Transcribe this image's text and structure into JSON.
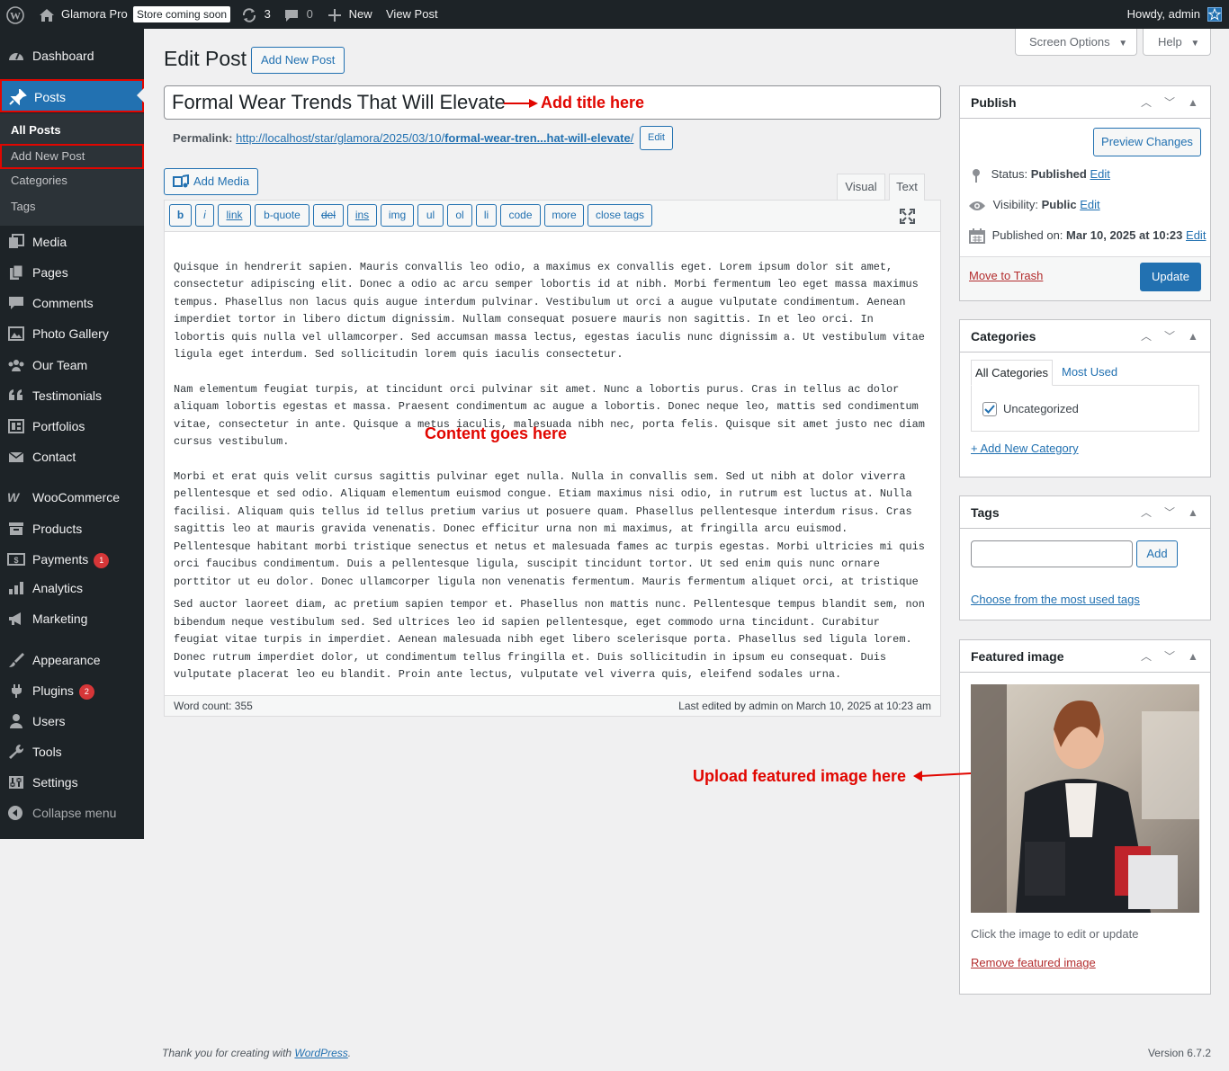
{
  "adminbar": {
    "site_name": "Glamora Pro",
    "store_badge": "Store coming soon",
    "updates_count": "3",
    "comments_count": "0",
    "new_label": "New",
    "view_post_label": "View Post",
    "howdy": "Howdy, admin"
  },
  "sidebar": {
    "dashboard": "Dashboard",
    "posts": "Posts",
    "all_posts": "All Posts",
    "add_new_post": "Add New Post",
    "categories": "Categories",
    "tags": "Tags",
    "media": "Media",
    "pages": "Pages",
    "comments": "Comments",
    "photo_gallery": "Photo Gallery",
    "our_team": "Our Team",
    "testimonials": "Testimonials",
    "portfolios": "Portfolios",
    "contact": "Contact",
    "woocommerce": "WooCommerce",
    "products": "Products",
    "payments": "Payments",
    "payments_badge": "1",
    "analytics": "Analytics",
    "marketing": "Marketing",
    "appearance": "Appearance",
    "plugins": "Plugins",
    "plugins_badge": "2",
    "users": "Users",
    "tools": "Tools",
    "settings": "Settings",
    "collapse": "Collapse menu"
  },
  "screen_options": "Screen Options",
  "help": "Help",
  "page_title": "Edit Post",
  "add_new_post_btn": "Add New Post",
  "post_title": "Formal Wear Trends That Will Elevate",
  "permalink": {
    "label": "Permalink:",
    "base": "http://localhost/star/glamora/2025/03/10/",
    "slug": "formal-wear-tren...hat-will-elevate",
    "trailing": "/",
    "edit": "Edit"
  },
  "add_media": "Add Media",
  "tabs": {
    "visual": "Visual",
    "text": "Text"
  },
  "quicktags": [
    "b",
    "i",
    "link",
    "b-quote",
    "del",
    "ins",
    "img",
    "ul",
    "ol",
    "li",
    "code",
    "more",
    "close tags"
  ],
  "content": [
    "Quisque in hendrerit sapien. Mauris convallis leo odio, a maximus ex convallis eget. Lorem ipsum dolor sit amet,\nconsectetur adipiscing elit. Donec a odio ac arcu semper lobortis id at nibh. Morbi fermentum leo eget massa maximus\ntempus. Phasellus non lacus quis augue interdum pulvinar. Vestibulum ut orci a augue vulputate condimentum. Aenean\nimperdiet tortor in libero dictum dignissim. Nullam consequat posuere mauris non sagittis. In et leo orci. In\nlobortis quis nulla vel ullamcorper. Sed accumsan massa lectus, egestas iaculis nunc dignissim a. Ut vestibulum vitae\nligula eget interdum. Sed sollicitudin lorem quis iaculis consectetur.",
    "Nam elementum feugiat turpis, at tincidunt orci pulvinar sit amet. Nunc a lobortis purus. Cras in tellus ac dolor\naliquam lobortis egestas et massa. Praesent condimentum ac augue a lobortis. Donec neque leo, mattis sed condimentum\nvitae, consectetur in ante. Quisque a metus iaculis, malesuada nibh nec, porta felis. Quisque sit amet justo nec diam\ncursus vestibulum.",
    "Morbi et erat quis velit cursus sagittis pulvinar eget nulla. Nulla in convallis sem. Sed ut nibh at dolor viverra\npellentesque et sed odio. Aliquam elementum euismod congue. Etiam maximus nisi odio, in rutrum est luctus at. Nulla\nfacilisi. Aliquam quis tellus id tellus pretium varius ut posuere quam. Phasellus pellentesque interdum risus. Cras\nsagittis leo at mauris gravida venenatis. Donec efficitur urna non mi maximus, at fringilla arcu euismod.\nPellentesque habitant morbi tristique senectus et netus et malesuada fames ac turpis egestas. Morbi ultricies mi quis\norci faucibus condimentum. Duis a pellentesque ligula, suscipit tincidunt tortor. Ut sed enim quis nunc ornare\nporttitor ut eu dolor. Donec ullamcorper ligula non venenatis fermentum. Mauris fermentum aliquet orci, at tristique",
    "Sed auctor laoreet diam, ac pretium sapien tempor et. Phasellus non mattis nunc. Pellentesque tempus blandit sem, non\nbibendum neque vestibulum sed. Sed ultrices leo id sapien pellentesque, eget commodo urna tincidunt. Curabitur\nfeugiat vitae turpis in imperdiet. Aenean malesuada nibh eget libero scelerisque porta. Phasellus sed ligula lorem.\nDonec rutrum imperdiet dolor, ut condimentum tellus fringilla et. Duis sollicitudin in ipsum eu consequat. Duis\nvulputate placerat leo eu blandit. Proin ante lectus, vulputate vel viverra quis, eleifend sodales urna."
  ],
  "word_count": "Word count: 355",
  "last_edited": "Last edited by admin on March 10, 2025 at 10:23 am",
  "annotations": {
    "title": "Add title here",
    "content": "Content goes here",
    "featured": "Upload featured image here"
  },
  "publish": {
    "title": "Publish",
    "preview": "Preview Changes",
    "status_label": "Status:",
    "status_value": "Published",
    "visibility_label": "Visibility:",
    "visibility_value": "Public",
    "published_label": "Published on:",
    "published_value": "Mar 10, 2025 at 10:23",
    "edit": "Edit",
    "trash": "Move to Trash",
    "update": "Update"
  },
  "categories": {
    "title": "Categories",
    "tab_all": "All Categories",
    "tab_most": "Most Used",
    "item": "Uncategorized",
    "add_new": "+ Add New Category"
  },
  "tags": {
    "title": "Tags",
    "add": "Add",
    "choose": "Choose from the most used tags"
  },
  "featured": {
    "title": "Featured image",
    "hint": "Click the image to edit or update",
    "remove": "Remove featured image"
  },
  "footer": {
    "thanks": "Thank you for creating with ",
    "wp_link": "WordPress",
    "period": ".",
    "version": "Version 6.7.2"
  },
  "colors": {
    "accent": "#2271b1",
    "annotation": "#e10600",
    "sidebar": "#1d2327"
  }
}
